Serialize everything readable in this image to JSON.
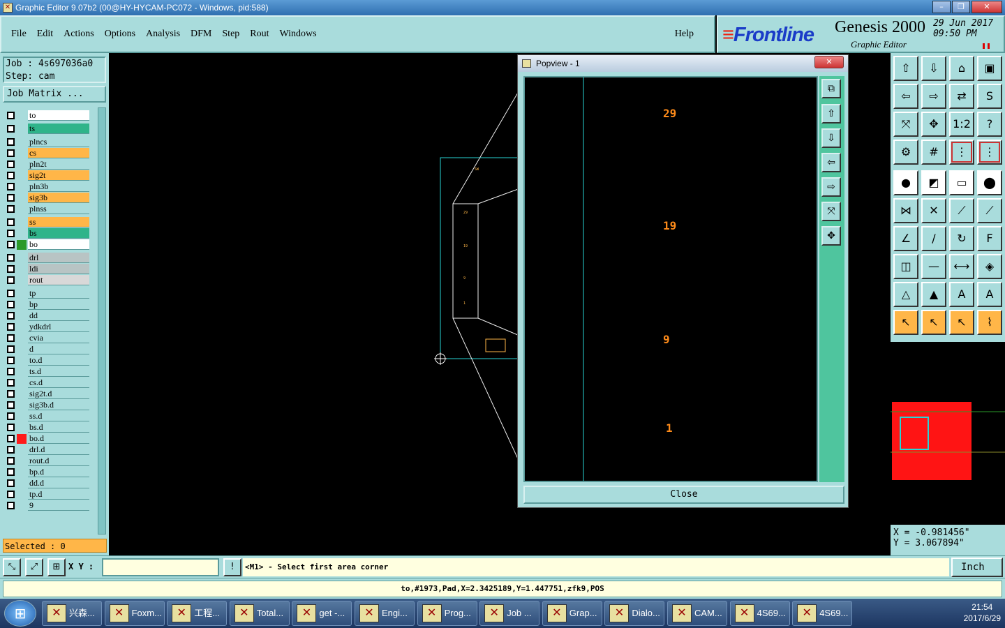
{
  "window": {
    "title": "Graphic Editor 9.07b2 (00@HY-HYCAM-PC072 - Windows, pid:588)"
  },
  "menu": {
    "items": [
      "File",
      "Edit",
      "Actions",
      "Options",
      "Analysis",
      "DFM",
      "Step",
      "Rout",
      "Windows"
    ],
    "help": "Help"
  },
  "brand": {
    "logo": "Frontline",
    "product": "Genesis 2000",
    "subtitle": "Graphic Editor",
    "date": "29 Jun 2017",
    "time": "09:50 PM"
  },
  "job": {
    "job_line": "Job : 4s697036a0",
    "step_line": "Step: cam",
    "matrix_button": "Job Matrix ..."
  },
  "layers": [
    {
      "name": "to",
      "color": "#ffffff",
      "swatch": ""
    },
    {
      "name": "ts",
      "color": "#2fb48a",
      "swatch": ""
    },
    {
      "name": "plncs",
      "color": "#a9dcdc",
      "swatch": ""
    },
    {
      "name": "cs",
      "color": "#ffb648",
      "swatch": ""
    },
    {
      "name": "pln2t",
      "color": "#a9dcdc",
      "swatch": ""
    },
    {
      "name": "sig2t",
      "color": "#ffb648",
      "swatch": ""
    },
    {
      "name": "pln3b",
      "color": "#a9dcdc",
      "swatch": ""
    },
    {
      "name": "sig3b",
      "color": "#ffb648",
      "swatch": ""
    },
    {
      "name": "plnss",
      "color": "#a9dcdc",
      "swatch": ""
    },
    {
      "name": "ss",
      "color": "#ffb648",
      "swatch": ""
    },
    {
      "name": "bs",
      "color": "#2fb48a",
      "swatch": ""
    },
    {
      "name": "bo",
      "color": "#ffffff",
      "swatch": "#2a9a2a"
    },
    {
      "name": "drl",
      "color": "#b8c4c4",
      "swatch": ""
    },
    {
      "name": "ldi",
      "color": "#b8c4c4",
      "swatch": ""
    },
    {
      "name": "rout",
      "color": "#d8d8d8",
      "swatch": ""
    },
    {
      "name": "tp",
      "color": "#a9dcdc",
      "swatch": ""
    },
    {
      "name": "bp",
      "color": "#a9dcdc",
      "swatch": ""
    },
    {
      "name": "dd",
      "color": "#a9dcdc",
      "swatch": ""
    },
    {
      "name": "ydkdrl",
      "color": "#a9dcdc",
      "swatch": ""
    },
    {
      "name": "cvia",
      "color": "#a9dcdc",
      "swatch": ""
    },
    {
      "name": "d",
      "color": "#a9dcdc",
      "swatch": ""
    },
    {
      "name": "to.d",
      "color": "#a9dcdc",
      "swatch": ""
    },
    {
      "name": "ts.d",
      "color": "#a9dcdc",
      "swatch": ""
    },
    {
      "name": "cs.d",
      "color": "#a9dcdc",
      "swatch": ""
    },
    {
      "name": "sig2t.d",
      "color": "#a9dcdc",
      "swatch": ""
    },
    {
      "name": "sig3b.d",
      "color": "#a9dcdc",
      "swatch": ""
    },
    {
      "name": "ss.d",
      "color": "#a9dcdc",
      "swatch": ""
    },
    {
      "name": "bs.d",
      "color": "#a9dcdc",
      "swatch": ""
    },
    {
      "name": "bo.d",
      "color": "#a9dcdc",
      "swatch": "#ff1a1a"
    },
    {
      "name": "drl.d",
      "color": "#a9dcdc",
      "swatch": ""
    },
    {
      "name": "rout.d",
      "color": "#a9dcdc",
      "swatch": ""
    },
    {
      "name": "bp.d",
      "color": "#a9dcdc",
      "swatch": ""
    },
    {
      "name": "dd.d",
      "color": "#a9dcdc",
      "swatch": ""
    },
    {
      "name": "tp.d",
      "color": "#a9dcdc",
      "swatch": ""
    },
    {
      "name": "9",
      "color": "#a9dcdc",
      "swatch": ""
    }
  ],
  "selected": "Selected : 0",
  "popview": {
    "title": "Popview - 1",
    "labels": [
      "29",
      "19",
      "9",
      "1"
    ],
    "close_label": "Close"
  },
  "coords": {
    "x": "X = -0.981456\"",
    "y": "Y = 3.067894\""
  },
  "status": {
    "xy_label": "X Y :",
    "xy_value": "",
    "message": "<M1> - Select first area corner",
    "unit": "Inch"
  },
  "info": "to,#1973,Pad,X=2.3425189,Y=1.447751,zfk9,POS",
  "taskbar": {
    "items": [
      "兴森...",
      "Foxm...",
      "工程...",
      "Total...",
      "get -...",
      "Engi...",
      "Prog...",
      "Job ...",
      "Grap...",
      "Dialo...",
      "CAM...",
      "4S69...",
      "4S69..."
    ],
    "time": "21:54",
    "date": "2017/6/29"
  }
}
